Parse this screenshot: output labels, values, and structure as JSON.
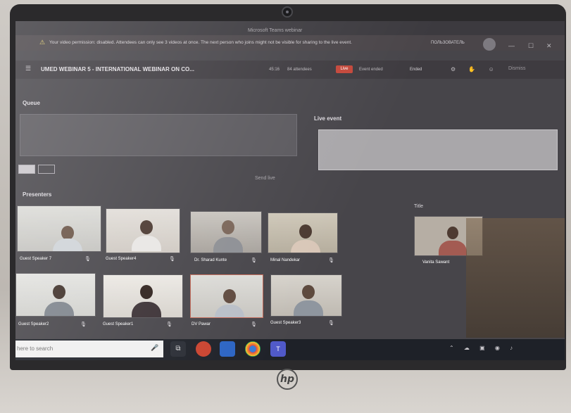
{
  "window": {
    "title_text": "Microsoft Teams webinar",
    "user_name": "ПОЛЬЗОВАТЕЛЬ",
    "notice": "Your video permission: disabled. Attendees can only see 3 videos at once. The next person who joins might not be visible for sharing to the live event.",
    "minimize": "—",
    "maximize": "☐",
    "close": "✕"
  },
  "meeting": {
    "title": "UMED WEBINAR 5 - INTERNATIONAL WEBINAR ON CO...",
    "time": "45:16",
    "attendees": "84 attendees",
    "live_badge": "Live",
    "event_status": "Event ended",
    "ended": "Ended",
    "leave": "Dismiss"
  },
  "sections": {
    "queue": "Queue",
    "live_event": "Live event",
    "presenters": "Presenters",
    "send_live": "Send live",
    "title_right": "Title"
  },
  "presenters": [
    {
      "name": "Guest Speaker 7",
      "mic": "🎙"
    },
    {
      "name": "Guest Speaker4",
      "mic": "🎙"
    },
    {
      "name": "Dr. Sharad Kunte",
      "mic": "🎙"
    },
    {
      "name": "Minal Nandekar",
      "mic": "🎙"
    },
    {
      "name": "Guest Speaker2",
      "mic": "🎙"
    },
    {
      "name": "Guest Speaker1",
      "mic": "🎙"
    },
    {
      "name": "DV Pawar",
      "mic": "🎙"
    },
    {
      "name": "Guest Speaker3",
      "mic": "🎙"
    }
  ],
  "right_tile": {
    "name": "Vanita Sawant"
  },
  "taskbar": {
    "search_placeholder": "here to search",
    "icons": [
      "task-view-icon",
      "office-icon",
      "store-icon",
      "chrome-icon",
      "teams-icon"
    ]
  },
  "laptop": {
    "logo": "hp"
  }
}
